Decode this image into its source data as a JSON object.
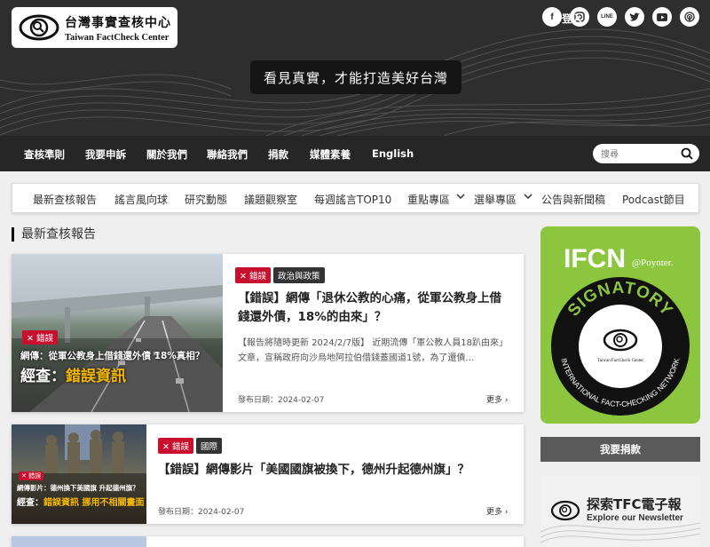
{
  "header": {
    "logo_title": "台灣事實查核中心",
    "logo_subtitle": "Taiwan FactCheck Center",
    "slogan": "看見真實，才能打造美好台灣",
    "social_icons": [
      "facebook-icon",
      "instagram-icon",
      "line-icon",
      "twitter-icon",
      "youtube-icon",
      "podcast-icon"
    ]
  },
  "nav": {
    "items": [
      "查核準則",
      "我要申訴",
      "關於我們",
      "聯絡我們",
      "捐款",
      "媒體素養",
      "English"
    ],
    "login": "登入",
    "search_placeholder": "搜尋"
  },
  "subnav": {
    "items": [
      "最新查核報告",
      "謠言風向球",
      "研究動態",
      "議題觀察室",
      "每週謠言TOP10",
      "重點專區",
      "選舉專區",
      "公告與新聞稿",
      "Podcast節目"
    ]
  },
  "section_title": "最新查核報告",
  "articles": [
    {
      "tags": [
        "錯誤",
        "政治與政策"
      ],
      "title": "【錯誤】網傳「退休公教的心痛，從軍公教身上借錢還外債，18%的由來」？",
      "excerpt": "【報告將隨時更新 2024/2/7版】 近期流傳「軍公教人員18趴由來」文章，宣稱政府向沙烏地阿拉伯借錢蓋國道1號，為了還債…",
      "date": "發布日期：2024-02-07",
      "more": "更多 ›",
      "thumb_badge": "錯誤",
      "thumb_caption": "網傳：從軍公教身上借錢還外債 18%真相？",
      "thumb_verdict_prefix": "經查：",
      "thumb_verdict": "錯誤資訊"
    },
    {
      "tags": [
        "錯誤",
        "國際"
      ],
      "title": "【錯誤】網傳影片「美國國旗被換下，德州升起德州旗」？",
      "date": "發布日期：2024-02-07",
      "more": "更多 ›",
      "thumb_badge": "錯誤",
      "thumb_caption": "網傳影片：德州換下美國旗 升起德州旗？",
      "thumb_verdict_prefix": "經查：",
      "thumb_verdict": "錯誤資訊 挪用不相關畫面"
    }
  ],
  "sidebar": {
    "ifcn_logo": "IFCN",
    "ifcn_partner": "@Poynter.",
    "signatory": "SIGNATORY",
    "network": "INTERNATIONAL FACT-CHECKING NETWORK",
    "donate": "我要捐款",
    "newsletter_title": "探索TFC電子報",
    "newsletter_subtitle": "Explore our Newsletter"
  }
}
